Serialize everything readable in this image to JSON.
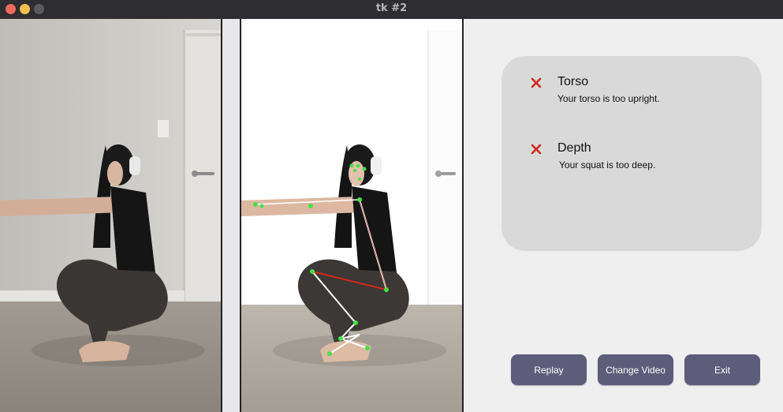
{
  "window": {
    "title": "tk #2"
  },
  "feedback": [
    {
      "icon": "cross-icon",
      "title": "Torso",
      "message": "Your torso is too upright."
    },
    {
      "icon": "cross-icon",
      "title": "Depth",
      "message": "Your squat is too deep."
    }
  ],
  "buttons": {
    "replay": "Replay",
    "change_video": "Change Video",
    "exit": "Exit"
  },
  "colors": {
    "titlebar": "#2e2d31",
    "close": "#ed6a5e",
    "minimize": "#f5bf4f",
    "zoom": "#5a595c",
    "card": "#d9d9d9",
    "button": "#5d5c7a",
    "error": "#d0281d",
    "landmark": "#46e046"
  }
}
